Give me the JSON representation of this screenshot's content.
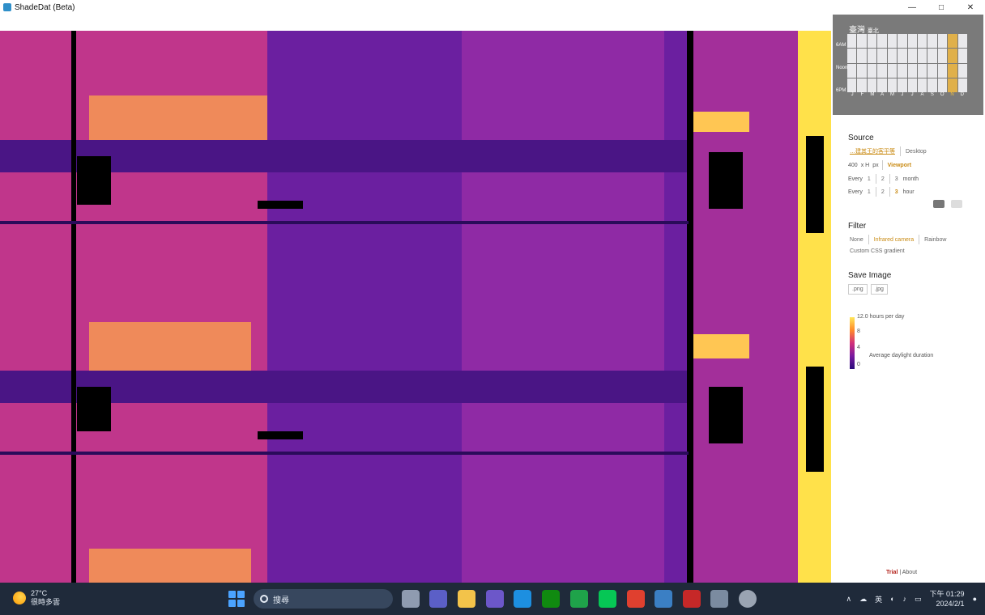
{
  "window": {
    "title": "ShadeDat (Beta)",
    "controls": [
      "—",
      "□",
      "✕"
    ]
  },
  "minimap": {
    "location": "臺灣",
    "sublocation": "臺北",
    "row_labels": [
      "6AM",
      "Noon",
      "6PM"
    ],
    "months": [
      "J",
      "F",
      "M",
      "A",
      "M",
      "J",
      "J",
      "A",
      "S",
      "O",
      "N",
      "D"
    ],
    "selected_month_index": 10
  },
  "source": {
    "title": "Source",
    "opt1": "…建其王的客平等",
    "opt2": "Desktop",
    "size_w": "400",
    "size_x": "x H",
    "size_unit": "px",
    "viewport": "Viewport",
    "every_label": "Every",
    "month_steps": [
      "1",
      "2",
      "3"
    ],
    "month_unit": "month",
    "hour_steps": [
      "1",
      "2",
      "3"
    ],
    "hour_unit": "hour"
  },
  "filter": {
    "title": "Filter",
    "options": [
      "None",
      "Infrared camera",
      "Rainbow",
      "Custom CSS gradient"
    ],
    "active_index": 1
  },
  "save_image": {
    "title": "Save Image",
    "png": ".png",
    "jpg": ".jpg"
  },
  "legend": {
    "max_label": "12.0 hours per day",
    "ticks": [
      "8",
      "4",
      "0"
    ],
    "caption": "Average daylight duration",
    "colors": [
      "#ffe85a",
      "#ff8a2a",
      "#d2307a",
      "#7a1aa0",
      "#2a0b7a"
    ]
  },
  "footer": {
    "trial": "Trial",
    "sep": "|",
    "about": "About"
  },
  "taskbar": {
    "temperature": "27°C",
    "weather": "很時多雲",
    "search_placeholder": "搜尋",
    "ime": "英",
    "time": "下午 01:29",
    "date": "2024/2/1"
  }
}
